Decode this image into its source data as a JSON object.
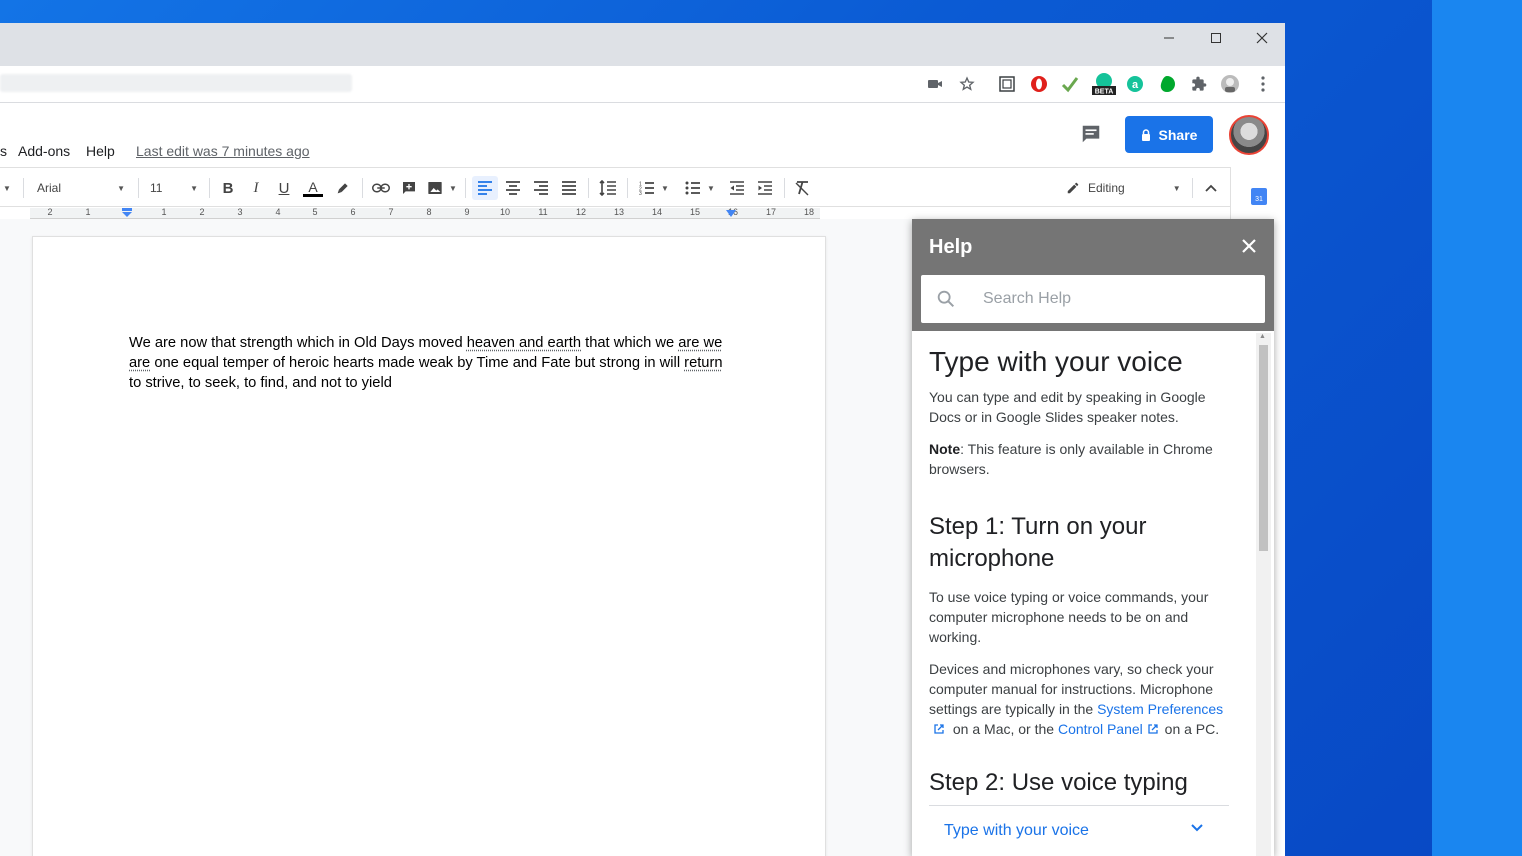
{
  "menu": {
    "partial_item": "s",
    "addons": "Add-ons",
    "help": "Help",
    "last_edit": "Last edit was 7 minutes ago"
  },
  "header": {
    "share_label": "Share"
  },
  "toolbar": {
    "font": "Arial",
    "font_size": "11",
    "editing_mode": "Editing",
    "text_color": "#000000"
  },
  "ruler": {
    "marks": [
      "2",
      "1",
      "1",
      "2",
      "3",
      "4",
      "5",
      "6",
      "7",
      "8",
      "9",
      "10",
      "11",
      "12",
      "13",
      "14",
      "15",
      "16",
      "17",
      "18"
    ]
  },
  "document": {
    "line1_a": "We are now that strength which in Old Days moved ",
    "line1_u1": "heaven and earth",
    "line1_b": " that which we ",
    "line1_u2": "are we",
    "line2_u1": "are",
    "line2_a": " one equal temper of heroic hearts made weak by Time and Fate but strong in will ",
    "line2_u2": "return",
    "line3": "to strive, to seek, to find, and not to yield"
  },
  "help_panel": {
    "title": "Help",
    "search_placeholder": "Search Help",
    "article_title": "Type with your voice",
    "intro": "You can type and edit by speaking in Google Docs or in Google Slides speaker notes.",
    "note_label": "Note",
    "note_text": ": This feature is only available in Chrome browsers.",
    "step1_title": "Step 1: Turn on your microphone",
    "step1_p1": "To use voice typing or voice commands, your computer microphone needs to be on and working.",
    "step1_p2_a": "Devices and microphones vary, so check your computer manual for instructions. Microphone settings are typically in the ",
    "step1_link1": "System Preferences",
    "step1_p2_b": " on a Mac, or the ",
    "step1_link2": "Control Panel",
    "step1_p2_c": " on a PC.",
    "step2_title": "Step 2: Use voice typing",
    "accordion_label": "Type with your voice"
  },
  "side_panel": {
    "calendar_day": "31"
  },
  "colors": {
    "accent": "#1a73e8",
    "help_header": "#757575",
    "desktop": "#0b5bd4"
  }
}
